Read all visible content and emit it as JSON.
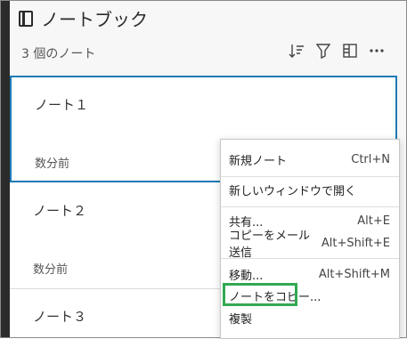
{
  "header": {
    "title": "ノートブック",
    "count": "3 個のノート"
  },
  "toolbar": {
    "icons": [
      "sort-icon",
      "filter-icon",
      "layout-icon",
      "more-icon"
    ]
  },
  "notes": [
    {
      "title": "ノート１",
      "time": "数分前"
    },
    {
      "title": "ノート２",
      "time": "数分前"
    },
    {
      "title": "ノート３",
      "time": ""
    }
  ],
  "context_menu": {
    "items": [
      {
        "label": "新規ノート",
        "shortcut": "Ctrl+N"
      },
      {
        "label": "新しいウィンドウで開く",
        "shortcut": ""
      },
      {
        "label": "共有...",
        "shortcut": "Alt+E"
      },
      {
        "label": "コピーをメール送信",
        "shortcut": "Alt+Shift+E"
      },
      {
        "label": "移動...",
        "shortcut": "Alt+Shift+M"
      },
      {
        "label": "ノートをコピー...",
        "shortcut": ""
      },
      {
        "label": "複製",
        "shortcut": ""
      }
    ]
  },
  "colors": {
    "selection_border": "#1e7bb6",
    "highlight_box": "#33a852"
  }
}
